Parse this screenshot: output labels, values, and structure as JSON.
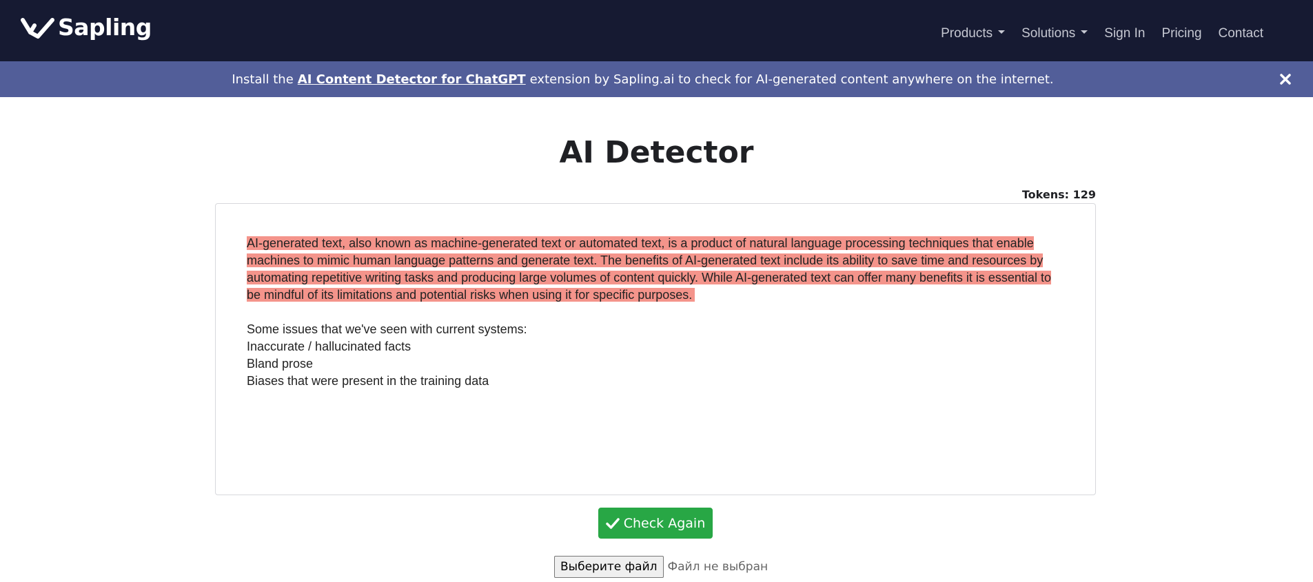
{
  "navbar": {
    "brand": "Sapling",
    "links": [
      {
        "label": "Products",
        "dropdown": true
      },
      {
        "label": "Solutions",
        "dropdown": true
      },
      {
        "label": "Sign In",
        "dropdown": false
      },
      {
        "label": "Pricing",
        "dropdown": false
      },
      {
        "label": "Contact",
        "dropdown": false
      }
    ]
  },
  "banner": {
    "prefix": "Install the",
    "link_text": "AI Content Detector for ChatGPT",
    "suffix": "extension by Sapling.ai to check for AI-generated content anywhere on the internet.",
    "close_icon": "close-icon"
  },
  "main": {
    "title": "AI Detector",
    "tokens": "Tokens: 129",
    "editor": {
      "highlighted_text": "AI-generated text, also known as machine-generated text or automated text, is a product of natural language processing techniques that enable machines to mimic human language patterns and generate text. The benefits of AI-generated text include its ability to save time and resources by automating repetitive writing tasks and producing large volumes of content quickly. While AI-generated text can offer many benefits it is essential to be mindful of its limitations and potential risks when using it for specific purposes.",
      "lines": [
        "Some issues that we've seen with current systems:",
        "Inaccurate / hallucinated facts",
        "Bland prose",
        "Biases that were present in the training data"
      ]
    },
    "check_button": "Check Again",
    "file_input": {
      "button_label": "Выберите файл",
      "status": "Файл не выбран"
    }
  },
  "colors": {
    "navbar_bg": "#161a32",
    "banner_bg": "#525e99",
    "highlight": "#f4948b",
    "button_green": "#28a745"
  }
}
